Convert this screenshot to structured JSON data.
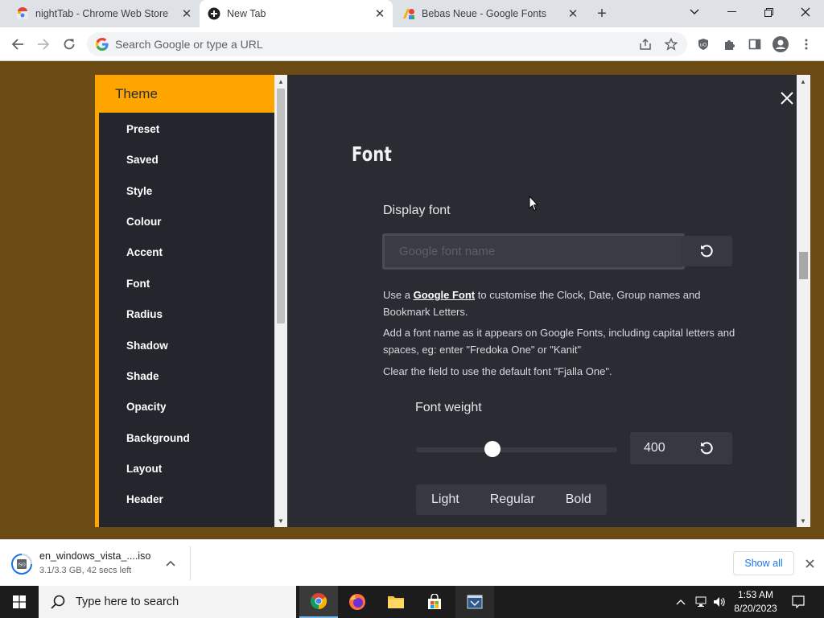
{
  "browser": {
    "tabs": [
      {
        "title": "nightTab - Chrome Web Store",
        "active": false
      },
      {
        "title": "New Tab",
        "active": true
      },
      {
        "title": "Bebas Neue - Google Fonts",
        "active": false
      }
    ],
    "address_placeholder": "Search Google or type a URL"
  },
  "sidebar": {
    "header": "Theme",
    "accent_color": "#ffa500",
    "items": [
      "Preset",
      "Saved",
      "Style",
      "Colour",
      "Accent",
      "Font",
      "Radius",
      "Shadow",
      "Shade",
      "Opacity",
      "Background",
      "Layout",
      "Header"
    ]
  },
  "main": {
    "section_title": "Font",
    "display_font": {
      "label": "Display font",
      "placeholder": "Google font name",
      "value": ""
    },
    "help": {
      "line1_prefix": "Use a ",
      "line1_link": "Google Font",
      "line1_suffix": " to customise the Clock, Date, Group names and Bookmark Letters.",
      "line2": "Add a font name as it appears on Google Fonts, including capital letters and spaces, eg: enter \"Fredoka One\" or \"Kanit\"",
      "line3": "Clear the field to use the default font \"Fjalla One\"."
    },
    "font_weight": {
      "label": "Font weight",
      "value": "400",
      "slider_fraction": 0.38,
      "presets": [
        "Light",
        "Regular",
        "Bold"
      ]
    }
  },
  "download_shelf": {
    "file_name": "en_windows_vista_....iso",
    "status": "3.1/3.3 GB, 42 secs left",
    "show_all": "Show all"
  },
  "taskbar": {
    "search_placeholder": "Type here to search",
    "time": "1:53 AM",
    "date": "8/20/2023"
  }
}
